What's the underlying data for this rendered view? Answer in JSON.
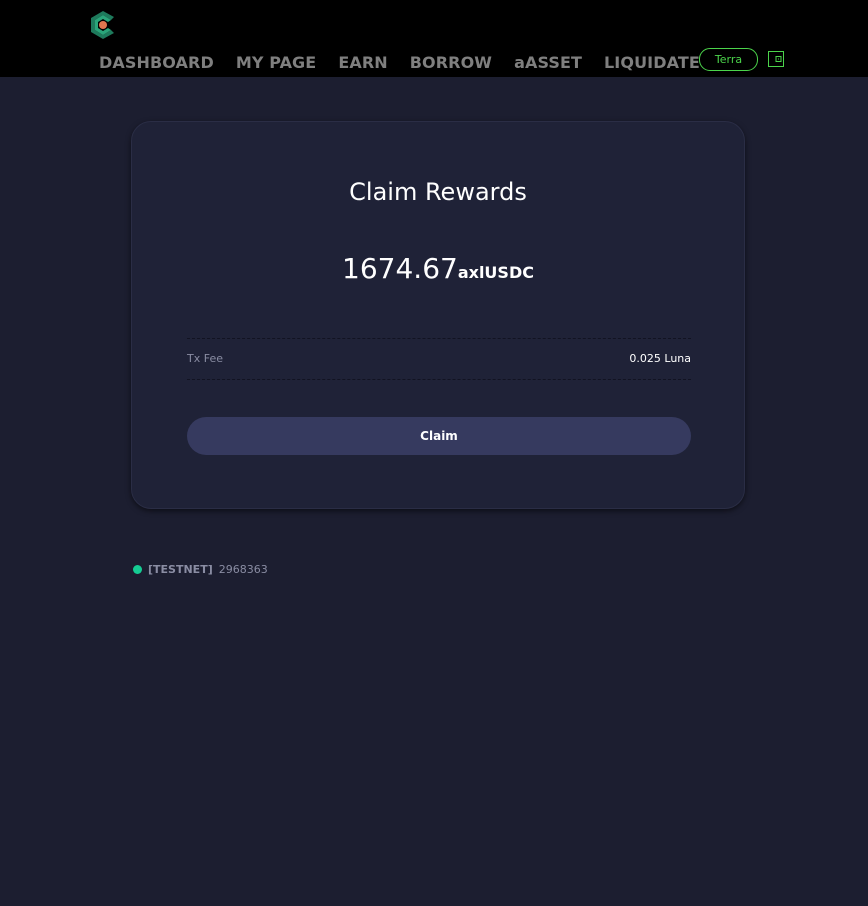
{
  "header": {
    "nav": [
      {
        "label": "DASHBOARD"
      },
      {
        "label": "MY PAGE"
      },
      {
        "label": "EARN"
      },
      {
        "label": "BORROW"
      },
      {
        "label": "aASSET"
      },
      {
        "label": "LIQUIDATE"
      }
    ],
    "network_button": "Terra",
    "logo_icon": "anchor-logo-icon",
    "wallet_icon": "wallet-icon"
  },
  "card": {
    "title": "Claim Rewards",
    "amount": "1674.67",
    "amount_unit": "axlUSDC",
    "fee_label": "Tx Fee",
    "fee_value": "0.025 Luna",
    "claim_button": "Claim"
  },
  "status": {
    "network": "[TESTNET]",
    "block": "2968363",
    "dot_color": "#15cc93"
  },
  "colors": {
    "accent_green": "#4bd44b",
    "background": "#1c1e30",
    "card": "#1f2237",
    "button": "#363a5f"
  }
}
